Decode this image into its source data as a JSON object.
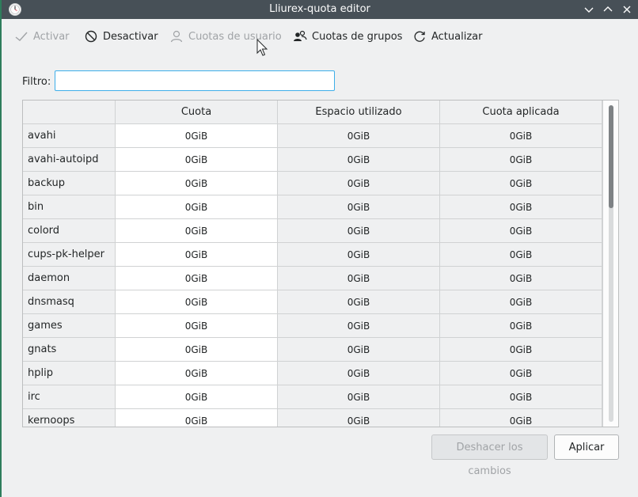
{
  "window": {
    "title": "Lliurex-quota editor"
  },
  "toolbar": {
    "activate_label": "Activar",
    "deactivate_label": "Desactivar",
    "user_quotas_label": "Cuotas de usuario",
    "group_quotas_label": "Cuotas de grupos",
    "refresh_label": "Actualizar"
  },
  "filter": {
    "label": "Filtro:",
    "value": "",
    "placeholder": ""
  },
  "table": {
    "columns": [
      "Cuota",
      "Espacio utilizado",
      "Cuota aplicada"
    ],
    "rows": [
      {
        "name": "avahi",
        "quota": "0GiB",
        "used": "0GiB",
        "applied": "0GiB"
      },
      {
        "name": "avahi-autoipd",
        "quota": "0GiB",
        "used": "0GiB",
        "applied": "0GiB"
      },
      {
        "name": "backup",
        "quota": "0GiB",
        "used": "0GiB",
        "applied": "0GiB"
      },
      {
        "name": "bin",
        "quota": "0GiB",
        "used": "0GiB",
        "applied": "0GiB"
      },
      {
        "name": "colord",
        "quota": "0GiB",
        "used": "0GiB",
        "applied": "0GiB"
      },
      {
        "name": "cups-pk-helper",
        "quota": "0GiB",
        "used": "0GiB",
        "applied": "0GiB"
      },
      {
        "name": "daemon",
        "quota": "0GiB",
        "used": "0GiB",
        "applied": "0GiB"
      },
      {
        "name": "dnsmasq",
        "quota": "0GiB",
        "used": "0GiB",
        "applied": "0GiB"
      },
      {
        "name": "games",
        "quota": "0GiB",
        "used": "0GiB",
        "applied": "0GiB"
      },
      {
        "name": "gnats",
        "quota": "0GiB",
        "used": "0GiB",
        "applied": "0GiB"
      },
      {
        "name": "hplip",
        "quota": "0GiB",
        "used": "0GiB",
        "applied": "0GiB"
      },
      {
        "name": "irc",
        "quota": "0GiB",
        "used": "0GiB",
        "applied": "0GiB"
      },
      {
        "name": "kernoops",
        "quota": "0GiB",
        "used": "0GiB",
        "applied": "0GiB"
      }
    ]
  },
  "buttons": {
    "undo_label": "Deshacer los cambios",
    "apply_label": "Aplicar"
  },
  "colors": {
    "titlebar": "#475057",
    "accent": "#3daee9",
    "background": "#eff0f1"
  }
}
